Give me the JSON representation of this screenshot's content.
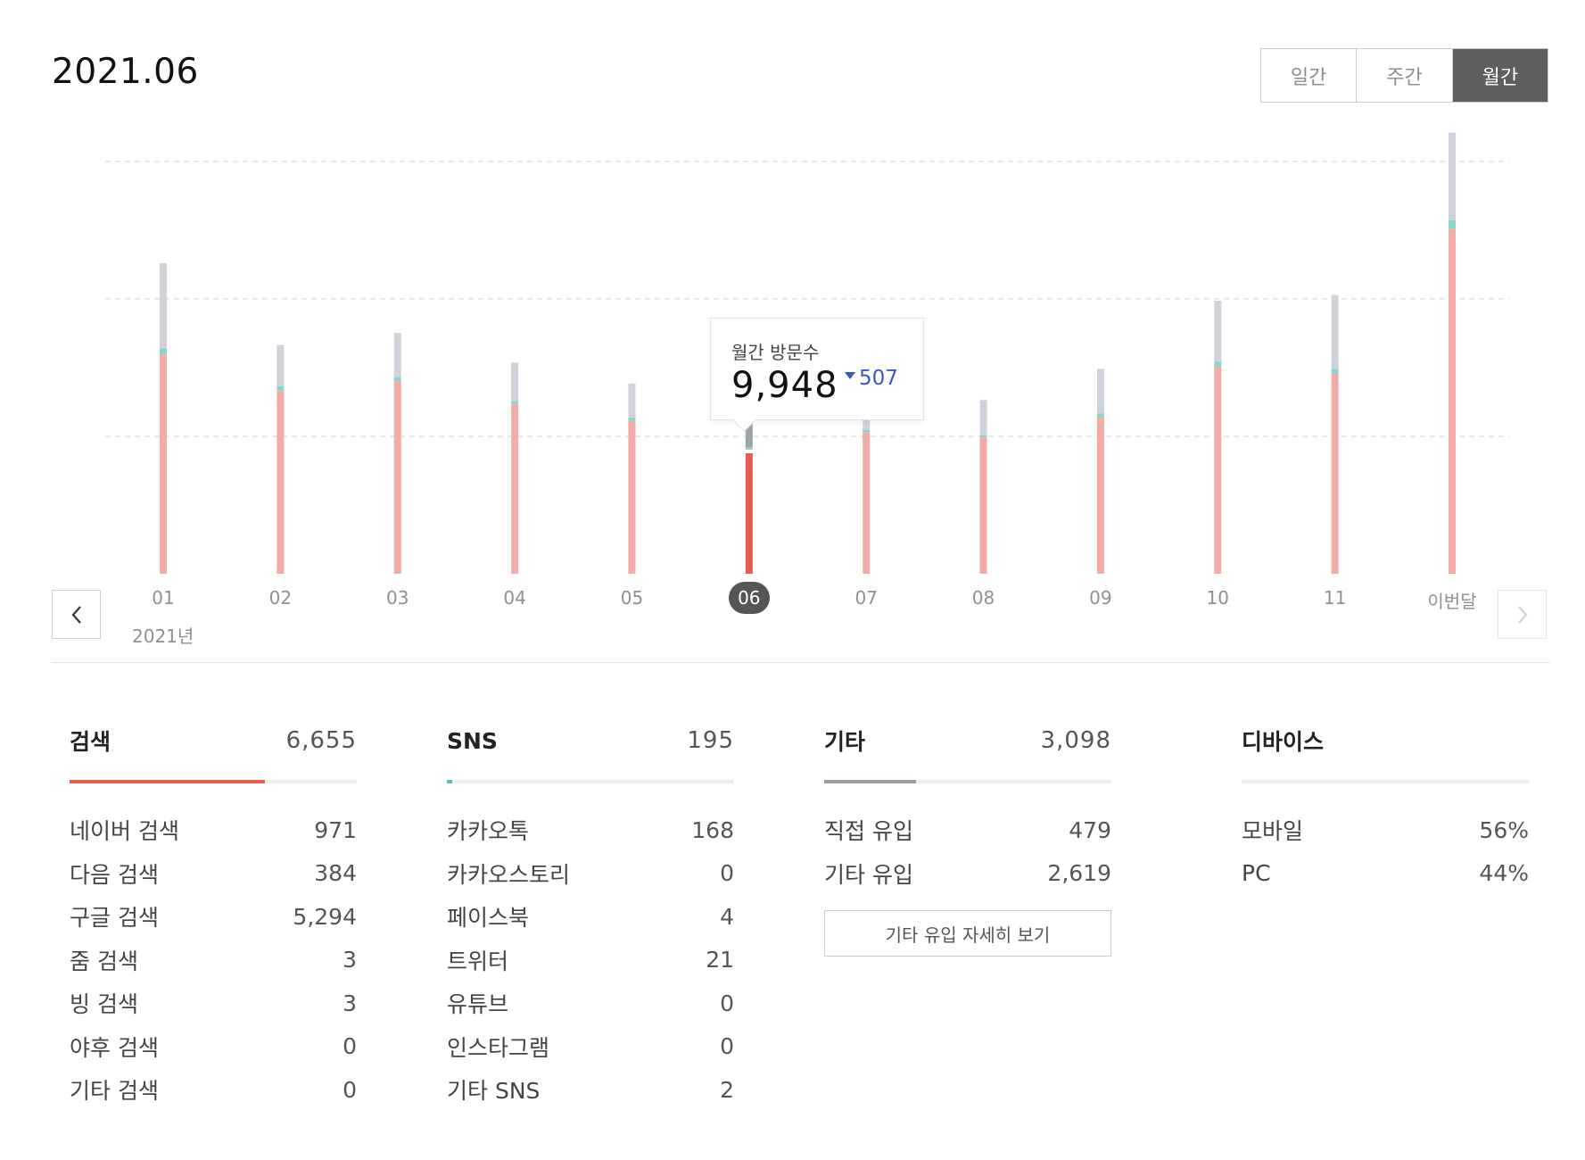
{
  "header": {
    "title": "2021.06"
  },
  "period_toggle": [
    {
      "label": "일간",
      "active": false
    },
    {
      "label": "주간",
      "active": false
    },
    {
      "label": "월간",
      "active": true
    }
  ],
  "chart_data": {
    "type": "bar",
    "categories": [
      "01",
      "02",
      "03",
      "04",
      "05",
      "06",
      "07",
      "08",
      "09",
      "10",
      "11",
      "이번달"
    ],
    "selected_index": 5,
    "year_label": "2021년",
    "series": [
      {
        "values": [
          7450,
          6220,
          6540,
          5770,
          5200,
          4090,
          4800,
          4630,
          5330,
          7060,
          6810,
          11720
        ]
      },
      {
        "values": [
          200,
          150,
          140,
          100,
          110,
          80,
          90,
          70,
          110,
          150,
          140,
          280
        ]
      },
      {
        "values": [
          2900,
          1400,
          1500,
          1300,
          1150,
          1780,
          2300,
          1200,
          1520,
          2060,
          2520,
          2980
        ]
      }
    ],
    "colors": [
      "#f3aba5",
      "#84d6cd",
      "#cfd2d8"
    ],
    "highlight_colors": [
      "#e75b4e",
      "#bfc2c8",
      "#9ea2a9"
    ],
    "ylim": [
      0,
      14000
    ],
    "grid": true,
    "tooltip": {
      "label": "월간 방문수",
      "value": "9,948",
      "delta": "507",
      "delta_direction": "down"
    }
  },
  "stats": {
    "search": {
      "title": "검색",
      "total": "6,655",
      "share": 0.68,
      "color": "#e8604f",
      "rows": [
        {
          "label": "네이버 검색",
          "value": "971"
        },
        {
          "label": "다음 검색",
          "value": "384"
        },
        {
          "label": "구글 검색",
          "value": "5,294"
        },
        {
          "label": "줌 검색",
          "value": "3"
        },
        {
          "label": "빙 검색",
          "value": "3"
        },
        {
          "label": "야후 검색",
          "value": "0"
        },
        {
          "label": "기타 검색",
          "value": "0"
        }
      ]
    },
    "sns": {
      "title": "SNS",
      "total": "195",
      "share": 0.02,
      "color": "#5bc1b4",
      "rows": [
        {
          "label": "카카오톡",
          "value": "168"
        },
        {
          "label": "카카오스토리",
          "value": "0"
        },
        {
          "label": "페이스북",
          "value": "4"
        },
        {
          "label": "트위터",
          "value": "21"
        },
        {
          "label": "유튜브",
          "value": "0"
        },
        {
          "label": "인스타그램",
          "value": "0"
        },
        {
          "label": "기타 SNS",
          "value": "2"
        }
      ]
    },
    "other": {
      "title": "기타",
      "total": "3,098",
      "share": 0.32,
      "color": "#9a9ea6",
      "rows": [
        {
          "label": "직접 유입",
          "value": "479"
        },
        {
          "label": "기타 유입",
          "value": "2,619"
        }
      ],
      "detail_button": "기타 유입 자세히 보기"
    },
    "device": {
      "title": "디바이스",
      "rows": [
        {
          "label": "모바일",
          "value": "56%"
        },
        {
          "label": "PC",
          "value": "44%"
        }
      ]
    }
  },
  "icons": {
    "prev": "chevron-left-icon",
    "next": "chevron-right-icon"
  }
}
